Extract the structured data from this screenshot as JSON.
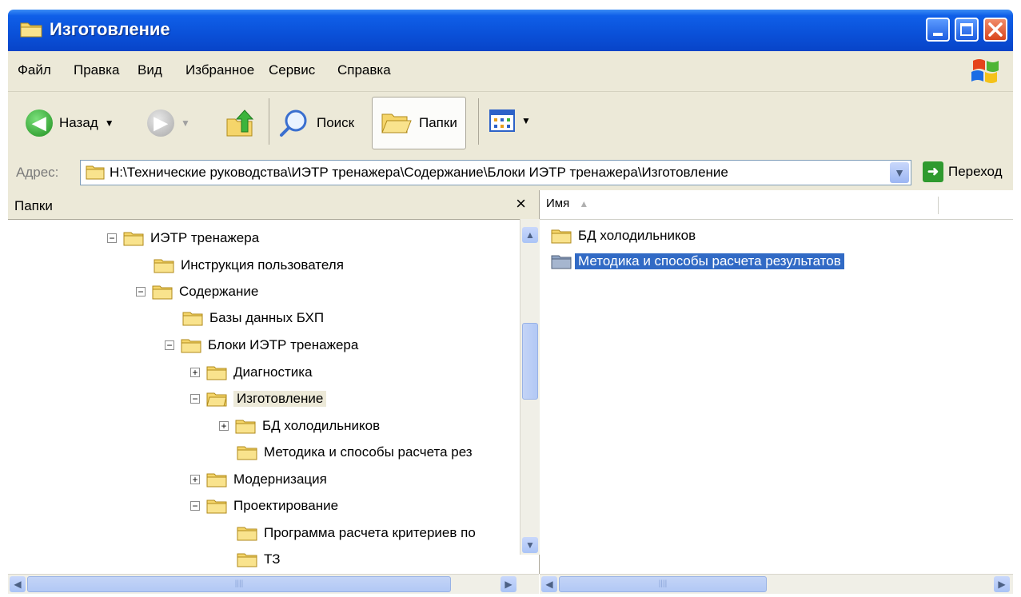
{
  "window": {
    "title": "Изготовление",
    "title_bar_color": "#0a50d8"
  },
  "menu": [
    "Файл",
    "Правка",
    "Вид",
    "Избранное",
    "Сервис",
    "Справка"
  ],
  "toolbar": {
    "back": "Назад",
    "search": "Поиск",
    "folders": "Папки"
  },
  "address": {
    "label": "Адрес:",
    "value": "H:\\Технические руководства\\ИЭТР тренажера\\Содержание\\Блоки ИЭТР тренажера\\Изготовление",
    "go": "Переход"
  },
  "folders_pane": {
    "header": "Папки",
    "close": "×",
    "tree": [
      {
        "label": "ИЭТР тренажера",
        "expander": "−"
      },
      {
        "label": "Инструкция пользователя",
        "expander": ""
      },
      {
        "label": "Содержание",
        "expander": "−"
      },
      {
        "label": "Базы данных БХП",
        "expander": ""
      },
      {
        "label": "Блоки ИЭТР тренажера",
        "expander": "−"
      },
      {
        "label": "Диагностика",
        "expander": "+"
      },
      {
        "label": "Изготовление",
        "expander": "−"
      },
      {
        "label": "БД холодильников",
        "expander": "+"
      },
      {
        "label": "Методика и способы расчета рез",
        "expander": ""
      },
      {
        "label": "Модернизация",
        "expander": "+"
      },
      {
        "label": "Проектирование",
        "expander": "−"
      },
      {
        "label": "Программа расчета критериев по",
        "expander": ""
      },
      {
        "label": "ТЗ",
        "expander": ""
      }
    ]
  },
  "files_pane": {
    "column_name": "Имя",
    "items": [
      {
        "label": "БД холодильников"
      },
      {
        "label": "Методика и способы расчета результатов"
      }
    ],
    "selection_color": "#316ac5"
  }
}
